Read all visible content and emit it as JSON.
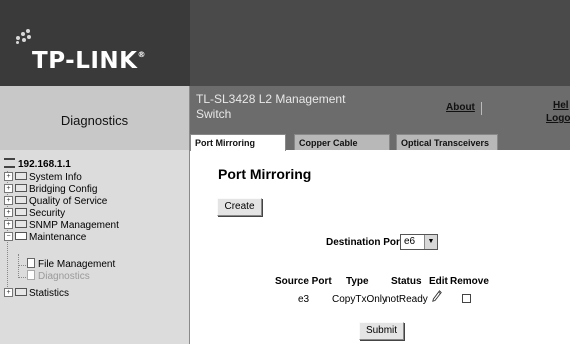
{
  "header": {
    "logo_text": "TP-LINK",
    "logo_mark": "®",
    "section_title": "Diagnostics",
    "device_title": "TL-SL3428 L2 Management Switch",
    "links": {
      "about": "About",
      "help": "Hel",
      "logout": "Logo"
    }
  },
  "tabs": [
    {
      "label": "Port Mirroring",
      "active": true
    },
    {
      "label": "Copper Cable",
      "active": false
    },
    {
      "label": "Optical Transceivers",
      "active": false
    }
  ],
  "sidebar": {
    "ip": "192.168.1.1",
    "items": [
      {
        "label": "System Info"
      },
      {
        "label": "Bridging Config"
      },
      {
        "label": "Quality of Service"
      },
      {
        "label": "Security"
      },
      {
        "label": "SNMP Management"
      },
      {
        "label": "Maintenance",
        "expanded": true
      },
      {
        "label": "File Management"
      },
      {
        "label": "Diagnostics",
        "selected": true
      },
      {
        "label": "Statistics"
      }
    ]
  },
  "main": {
    "title": "Port Mirroring",
    "create_label": "Create",
    "destination_port_label": "Destination Port",
    "destination_port_value": "e6",
    "table": {
      "headers": [
        "Source Port",
        "Type",
        "Status",
        "Edit",
        "Remove"
      ],
      "rows": [
        {
          "source_port": "e3",
          "type": "CopyTxOnly",
          "status": "notReady",
          "remove_checked": false
        }
      ]
    },
    "submit_label": "Submit"
  },
  "colors": {
    "banner": "#4a4a4a",
    "sidebar": "#dcdcdc",
    "tab_inactive": "#b8b8b8",
    "active_tab": "#ffffff"
  }
}
